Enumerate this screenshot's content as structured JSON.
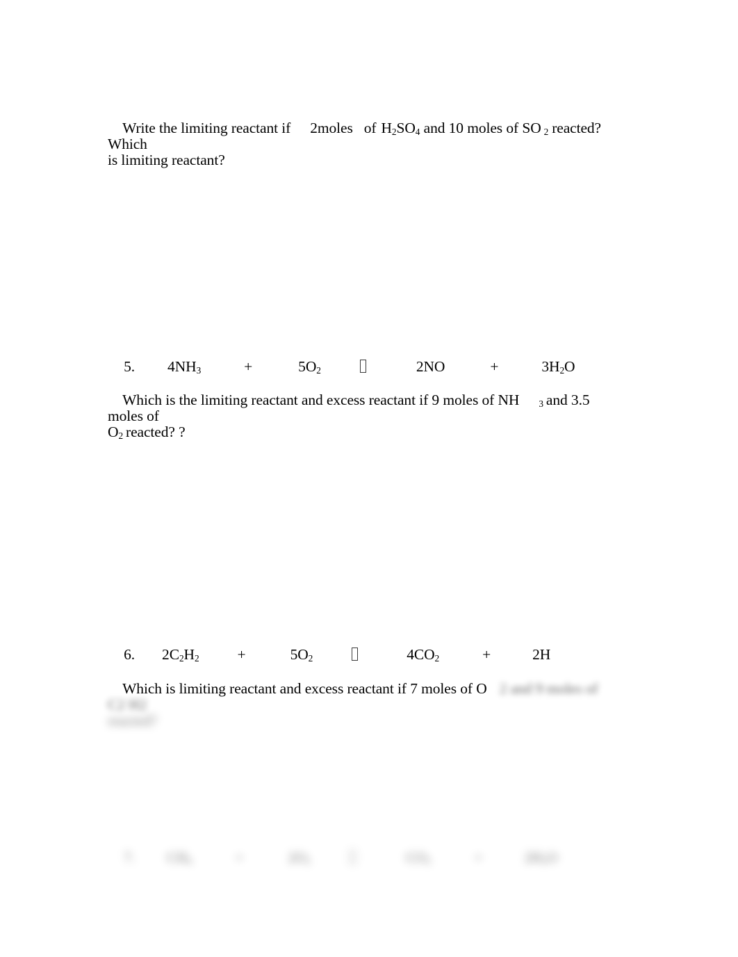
{
  "document": {
    "type": "worksheet",
    "subject": "Stoichiometry / Limiting Reactant",
    "background_color": "#ffffff",
    "text_color": "#000000"
  },
  "questions": {
    "q4": {
      "prompt_part1": "Write the limiting reactant if",
      "amount1": "2moles",
      "of": "of",
      "formula1_base": "H",
      "formula1_sub1": "2",
      "formula1_mid": "SO",
      "formula1_sub2": "4",
      "middle": "and 10 moles of SO",
      "formula2_sub": "2",
      "prompt_tail": "reacted? Which",
      "line2": "is limiting reactant?"
    },
    "q5": {
      "number": "5.",
      "reactant1_coeff": "4NH",
      "reactant1_sub": "3",
      "plus1": "+",
      "reactant2_coeff": "5O",
      "reactant2_sub": "2",
      "arrow": "missing-glyph-box",
      "product1": "2NO",
      "plus2": "+",
      "product2_pre": "3H",
      "product2_sub": "2",
      "product2_post": "O",
      "text_part1": "Which is the limiting reactant and excess reactant if 9 moles of NH",
      "text_sub": "3",
      "text_part2": "and 3.5 moles of",
      "text_line2_pre": "O",
      "text_line2_sub": "2",
      "text_line2_post": "reacted? ?"
    },
    "q6": {
      "number": "6.",
      "reactant1_pre": "2C",
      "reactant1_sub1": "2",
      "reactant1_mid": "H",
      "reactant1_sub2": "2",
      "plus1": "+",
      "reactant2_coeff": "5O",
      "reactant2_sub": "2",
      "arrow": "missing-glyph-box",
      "product1_pre": "4CO",
      "product1_sub": "2",
      "plus2": "+",
      "product2": "2H",
      "text_part1": "Which is limiting reactant and excess reactant if 7 moles of O",
      "text_blurred_tail": "2 and 9 moles of  C2 H2",
      "text_line2_blurred": "reacted?"
    },
    "q7": {
      "number": "7.",
      "reactant1_pre": "CH",
      "reactant1_sub": "4",
      "plus1": "+",
      "reactant2_pre": "2O",
      "reactant2_sub": "2",
      "arrow": "missing-glyph-box",
      "product1_pre": "CO",
      "product1_sub": "2",
      "plus2": "+",
      "product2_pre": "2H",
      "product2_sub": "2",
      "product2_post": "O",
      "blurred": true
    }
  }
}
